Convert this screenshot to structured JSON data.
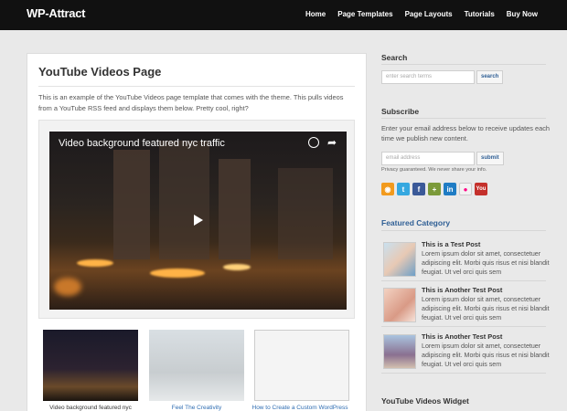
{
  "header": {
    "logo": "WP-Attract",
    "nav": [
      "Home",
      "Page Templates",
      "Page Layouts",
      "Tutorials",
      "Buy Now"
    ]
  },
  "main": {
    "title": "YouTube Videos Page",
    "intro": "This is an example of the YouTube Videos page template that comes with the theme. This pulls videos from a YouTube RSS feed and displays them below. Pretty cool, right?",
    "video": {
      "title": "Video background featured nyc traffic"
    },
    "thumbnails": [
      {
        "caption": "Video background featured nyc"
      },
      {
        "caption": "Feel The Creativity"
      },
      {
        "caption": "How to Create a Custom WordPress"
      }
    ]
  },
  "sidebar": {
    "search": {
      "title": "Search",
      "placeholder": "enter search terms",
      "button": "search"
    },
    "subscribe": {
      "title": "Subscribe",
      "text": "Enter your email address below to receive updates each time we publish new content.",
      "placeholder": "email address",
      "button": "submit",
      "privacy": "Privacy guaranteed. We never share your info."
    },
    "featured": {
      "title": "Featured Category",
      "posts": [
        {
          "title": "This is a Test Post",
          "excerpt": "Lorem ipsum dolor sit amet, consectetuer adipiscing elit. Morbi quis risus et nisi blandit feugiat. Ut vel orci quis sem"
        },
        {
          "title": "This is Another Test Post",
          "excerpt": "Lorem ipsum dolor sit amet, consectetuer adipiscing elit. Morbi quis risus et nisi blandit feugiat. Ut vel orci quis sem"
        },
        {
          "title": "This is Another Test Post",
          "excerpt": "Lorem ipsum dolor sit amet, consectetuer adipiscing elit. Morbi quis risus et nisi blandit feugiat. Ut vel orci quis sem"
        }
      ]
    },
    "youtube_widget": {
      "title": "YouTube Videos Widget"
    }
  },
  "colors": {
    "header": "#111111",
    "accent": "#2f5f95",
    "link": "#2f6db2"
  },
  "icons": [
    "rss-icon",
    "twitter-icon",
    "facebook-icon",
    "google-plus-icon",
    "linkedin-icon",
    "flickr-icon",
    "youtube-icon"
  ]
}
